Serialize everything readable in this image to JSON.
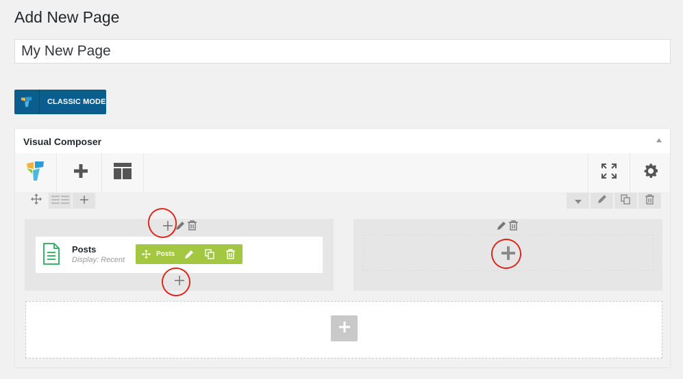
{
  "page": {
    "heading": "Add New Page"
  },
  "title_field": {
    "value": "My New Page"
  },
  "classic_mode": {
    "label": "CLASSIC MODE"
  },
  "composer": {
    "title": "Visual Composer",
    "columns": [
      {
        "element": {
          "title": "Posts",
          "description": "Display: Recent",
          "controls_label": "Posts"
        }
      },
      {}
    ]
  },
  "colors": {
    "accent_blue": "#0a5e8d",
    "element_controls": "#a3c740",
    "annotation_red": "#e0261b"
  },
  "icons": [
    "vc-logo-icon",
    "add-element-icon",
    "templates-icon",
    "fullscreen-icon",
    "gear-icon",
    "move-icon",
    "layout-icon",
    "plus-icon",
    "chevron-down-icon",
    "pencil-icon",
    "clone-icon",
    "trash-icon",
    "document-icon"
  ]
}
